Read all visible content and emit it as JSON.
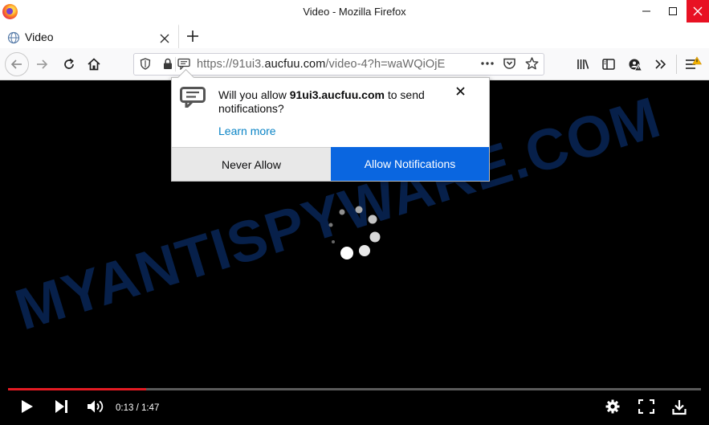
{
  "window": {
    "title": "Video - Mozilla Firefox"
  },
  "tab": {
    "label": "Video"
  },
  "url": {
    "prefix": "https://91ui3.",
    "domain": "aucfuu.com",
    "suffix": "/video-4?h=waWQiOjE"
  },
  "popup": {
    "text_before": "Will you allow ",
    "site": "91ui3.aucfuu.com",
    "text_after": " to send notifications?",
    "learn_more": "Learn more",
    "never_allow": "Never Allow",
    "allow": "Allow Notifications"
  },
  "player": {
    "time": "0:13 / 1:47",
    "progress": 0.199
  },
  "watermark": "MYANTISPYWARE.COM",
  "colors": {
    "allow_button": "#0a66e0",
    "progress": "#e31b23",
    "close_button": "#e81123"
  }
}
